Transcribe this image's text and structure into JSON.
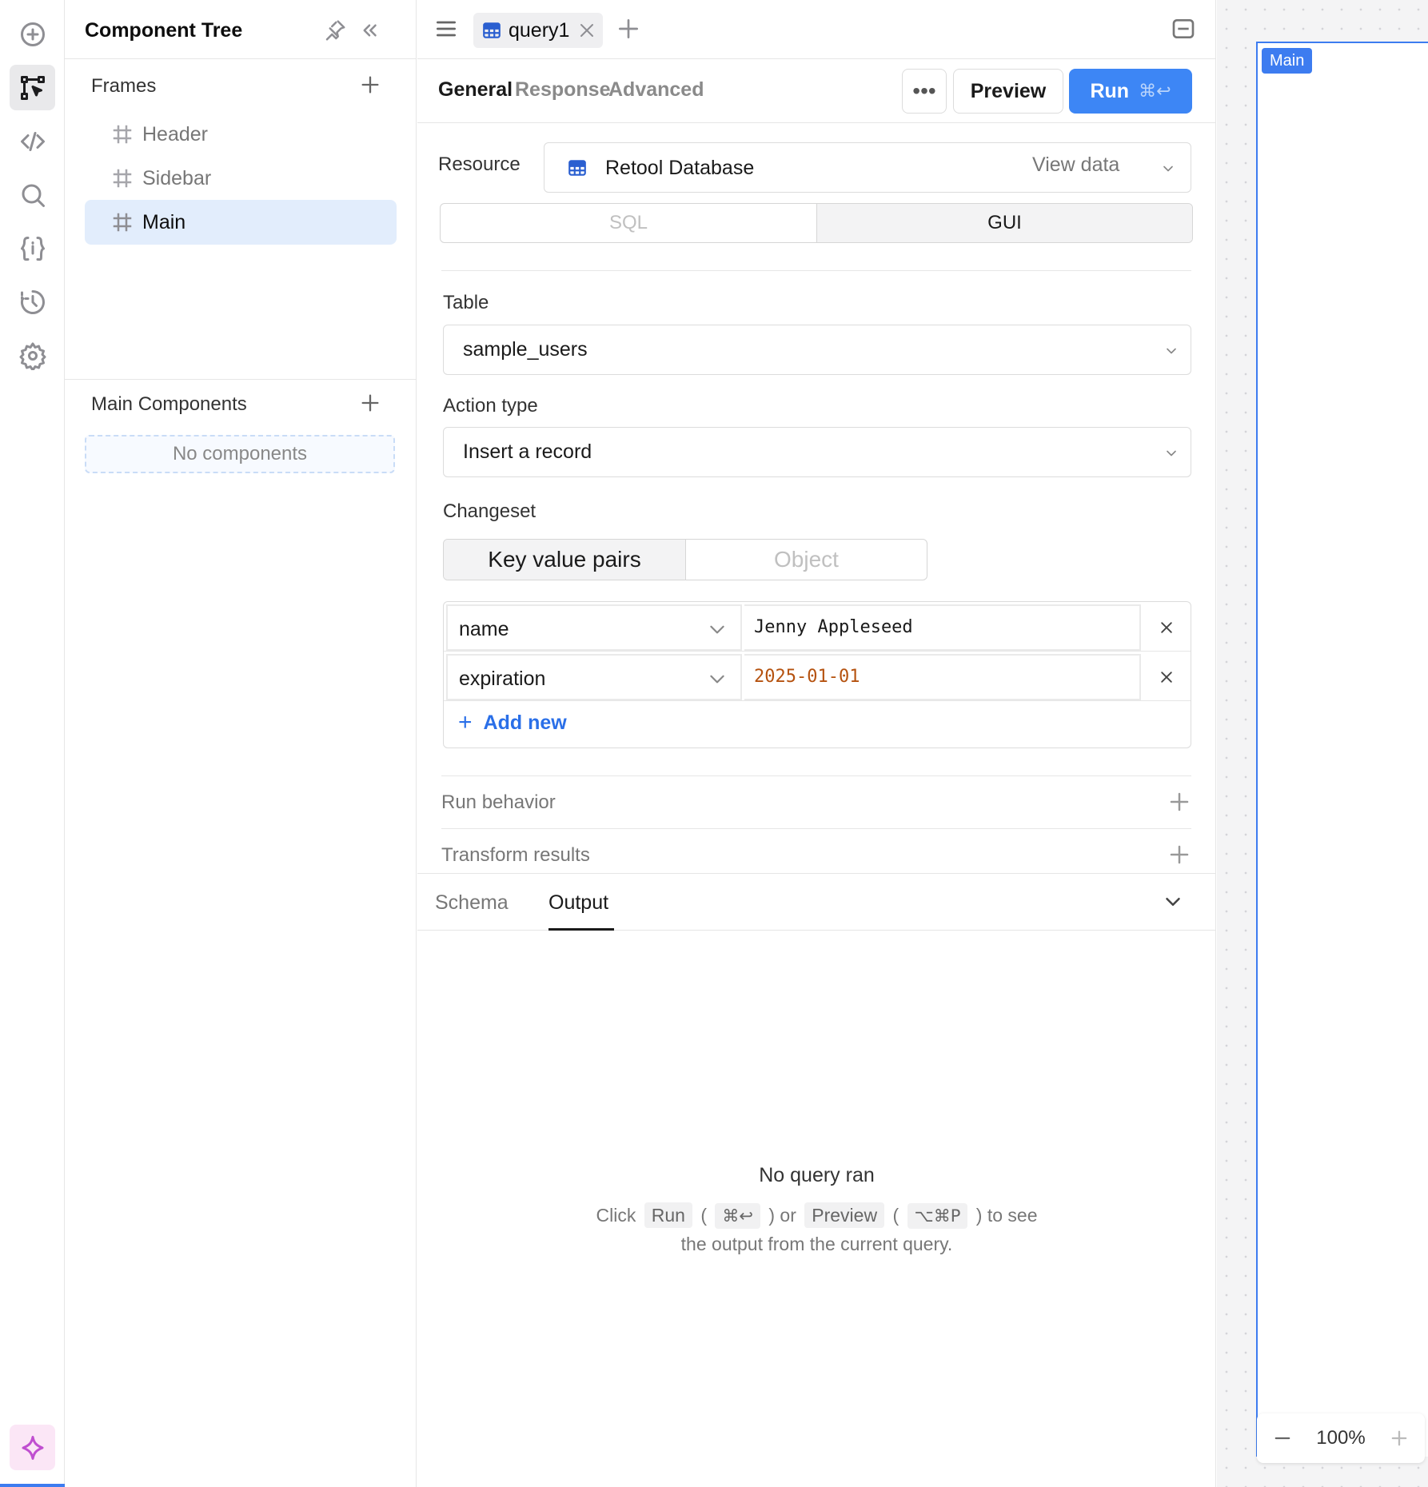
{
  "tree": {
    "title": "Component Tree",
    "frames_title": "Frames",
    "frames": [
      {
        "label": "Header",
        "selected": false
      },
      {
        "label": "Sidebar",
        "selected": false
      },
      {
        "label": "Main",
        "selected": true
      }
    ],
    "components_title": "Main Components",
    "no_components": "No components"
  },
  "editor": {
    "query_tab": "query1",
    "tabs": {
      "general": "General",
      "response": "Response",
      "advanced": "Advanced"
    },
    "actions": {
      "more": "•••",
      "preview": "Preview",
      "run": "Run",
      "run_shortcut": "⌘↩"
    },
    "resource": {
      "label": "Resource",
      "value": "Retool Database",
      "view_data": "View data"
    },
    "mode": {
      "sql": "SQL",
      "gui": "GUI",
      "selected": "GUI"
    },
    "table": {
      "label": "Table",
      "value": "sample_users"
    },
    "action_type": {
      "label": "Action type",
      "value": "Insert a record"
    },
    "changeset": {
      "label": "Changeset",
      "modes": {
        "kv": "Key value pairs",
        "object": "Object",
        "selected": "Key value pairs"
      },
      "rows": [
        {
          "key": "name",
          "value": "Jenny Appleseed"
        },
        {
          "key": "expiration",
          "value": "2025-01-01"
        }
      ],
      "add_new": "Add new"
    },
    "sections": {
      "run_behavior": "Run behavior",
      "transform_results": "Transform results"
    },
    "output": {
      "tabs": {
        "schema": "Schema",
        "output": "Output",
        "selected": "Output"
      },
      "empty_title": "No query ran",
      "hint": {
        "click": "Click",
        "run": "Run",
        "paren_open": "(",
        "run_kbd": "⌘↩",
        "paren_close_or": ") or",
        "preview": "Preview",
        "paren_open2": "(",
        "preview_kbd": "⌥⌘P",
        "paren_close_to": ") to see",
        "line2": "the output from the current query."
      }
    }
  },
  "canvas": {
    "frame_badge": "Main",
    "zoom": "100%"
  },
  "colors": {
    "accent": "#3d86f5",
    "selected_bg": "#e2edfc",
    "date_value": "#b5520f",
    "ai_accent": "#c04fd0"
  },
  "icons": [
    "add-circle-icon",
    "component-tree-icon",
    "code-icon",
    "search-icon",
    "state-icon",
    "history-icon",
    "settings-icon",
    "sparkle-icon",
    "pin-icon",
    "collapse-left-icon",
    "frame-hash-icon",
    "plus-icon",
    "menu-icon",
    "table-icon",
    "close-icon",
    "panel-collapse-icon",
    "chevron-down-icon"
  ]
}
